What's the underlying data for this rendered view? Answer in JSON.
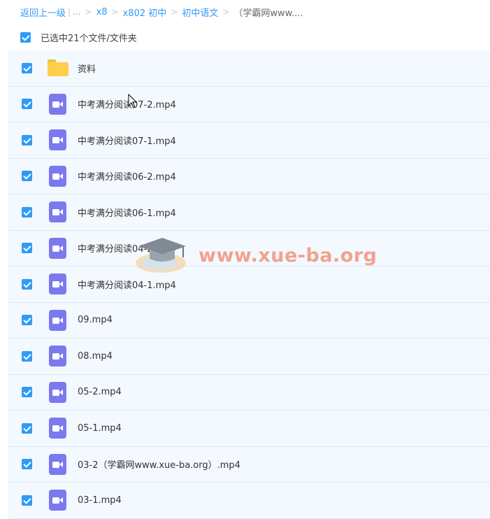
{
  "breadcrumb": {
    "back_label": "返回上一级",
    "ellipsis": "...",
    "crumbs": [
      "x8",
      "x802 初中",
      "初中语文"
    ],
    "current": "（学霸网www...."
  },
  "selection": {
    "label": "已选中21个文件/文件夹",
    "checked": true
  },
  "files": [
    {
      "name": "资料",
      "type": "folder",
      "checked": true
    },
    {
      "name": "中考满分阅读07-2.mp4",
      "type": "video",
      "checked": true
    },
    {
      "name": "中考满分阅读07-1.mp4",
      "type": "video",
      "checked": true
    },
    {
      "name": "中考满分阅读06-2.mp4",
      "type": "video",
      "checked": true
    },
    {
      "name": "中考满分阅读06-1.mp4",
      "type": "video",
      "checked": true
    },
    {
      "name": "中考满分阅读04-2.mp4",
      "type": "video",
      "checked": true
    },
    {
      "name": "中考满分阅读04-1.mp4",
      "type": "video",
      "checked": true
    },
    {
      "name": "09.mp4",
      "type": "video",
      "checked": true
    },
    {
      "name": "08.mp4",
      "type": "video",
      "checked": true
    },
    {
      "name": "05-2.mp4",
      "type": "video",
      "checked": true
    },
    {
      "name": "05-1.mp4",
      "type": "video",
      "checked": true
    },
    {
      "name": "03-2（学霸网www.xue-ba.org）.mp4",
      "type": "video",
      "checked": true
    },
    {
      "name": "03-1.mp4",
      "type": "video",
      "checked": true
    }
  ],
  "watermark": {
    "text": "www.xue-ba.org"
  },
  "colors": {
    "accent": "#2f9bf5",
    "row_bg": "#f3f9fe",
    "video_icon": "#7b78f0",
    "folder_icon": "#fdcf4d",
    "watermark": "#f2856c"
  }
}
